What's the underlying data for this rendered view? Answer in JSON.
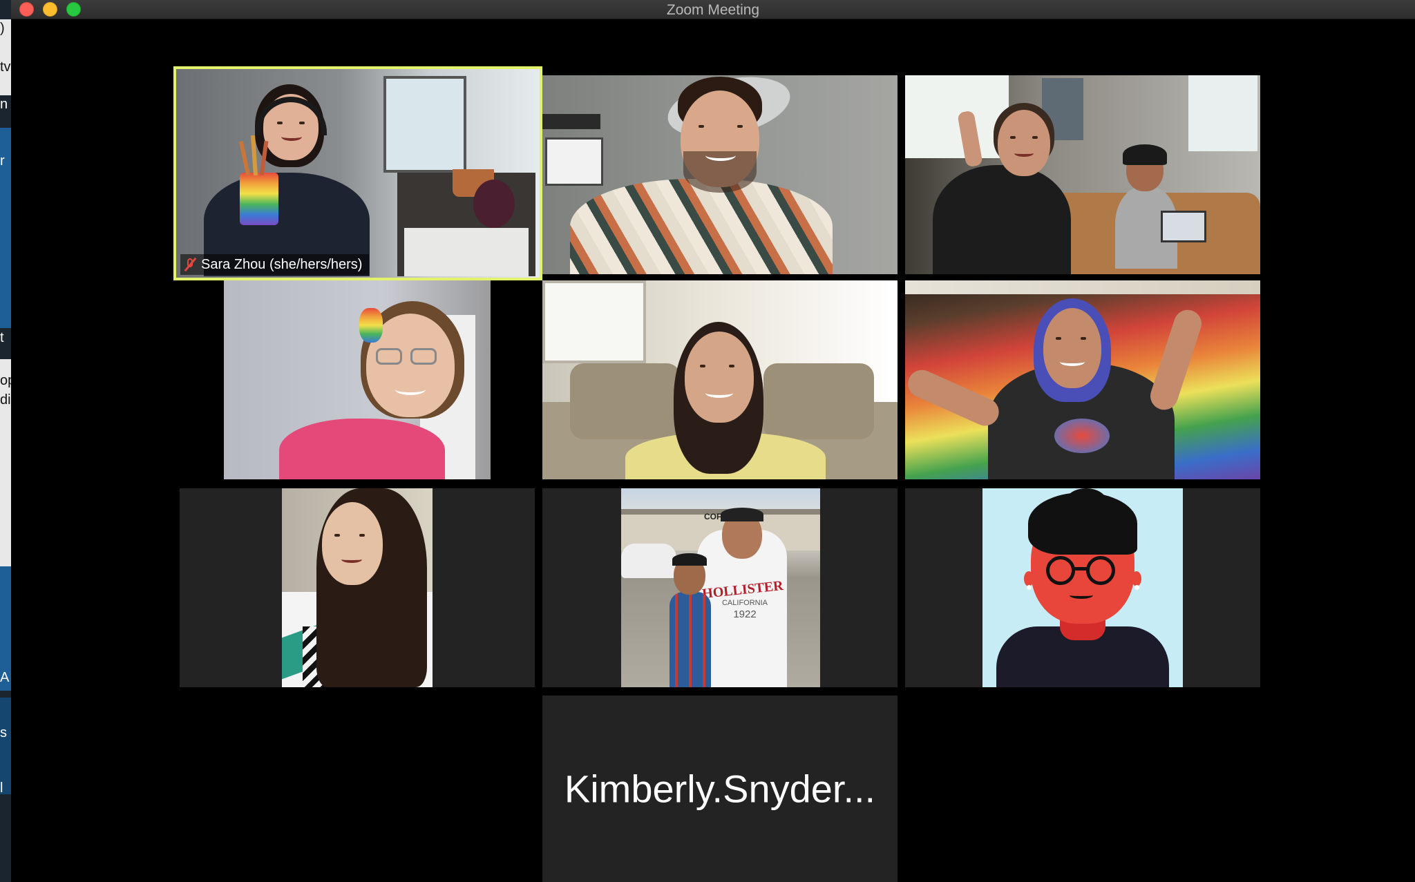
{
  "window": {
    "title": "Zoom Meeting"
  },
  "background_window": {
    "text_fragments": [
      ")",
      "tv",
      "n",
      "r",
      "t",
      "op",
      "di",
      "A",
      "s",
      "l"
    ]
  },
  "gallery": {
    "active_speaker": "Sara Zhou (she/hers/hers)",
    "participants": [
      {
        "id": "p1",
        "name_label": "Sara Zhou (she/hers/hers)",
        "muted": true,
        "video": "on"
      },
      {
        "id": "p2",
        "video": "on"
      },
      {
        "id": "p3",
        "video": "on"
      },
      {
        "id": "p4",
        "video": "on"
      },
      {
        "id": "p5",
        "video": "on"
      },
      {
        "id": "p6",
        "video": "on"
      },
      {
        "id": "p7",
        "video": "profile-photo"
      },
      {
        "id": "p8",
        "video": "profile-photo",
        "photo_text": [
          "HOLLISTER",
          "CALIFORNIA",
          "1922",
          "COFFEE"
        ]
      },
      {
        "id": "p9",
        "video": "avatar-illustration"
      },
      {
        "id": "p10",
        "display_name": "Kimberly.Snyder...",
        "video": "off"
      }
    ]
  },
  "colors": {
    "active_border": "#e2f26a",
    "tile_bg": "#232323",
    "mute_red": "#e5463d"
  },
  "icons": [
    "close-window-icon",
    "minimize-window-icon",
    "maximize-window-icon",
    "muted-microphone-icon"
  ]
}
